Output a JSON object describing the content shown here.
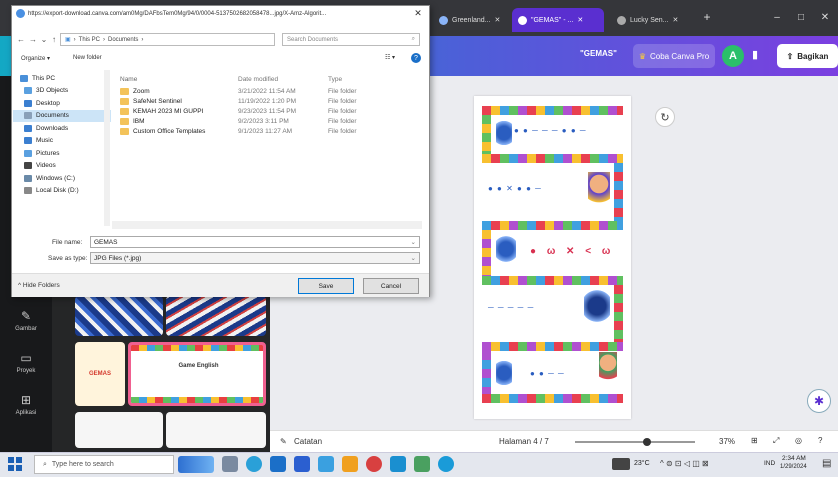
{
  "browser": {
    "popup_url": "https://export-download.canva.com/am0Mg/DAFbsTem0Mg/94/0/0004-5137502682058478...jpg/X-Amz-Algorit...",
    "tabs": [
      {
        "label": "Greenland..."
      },
      {
        "label": "\"GEMAS\" - ...",
        "active": true
      },
      {
        "label": "Lucky Sen..."
      }
    ],
    "new_tab": "+",
    "win_controls": [
      "–",
      "□",
      "✕"
    ]
  },
  "canva": {
    "doc_title": "\"GEMAS\"",
    "pro_button": "Coba Canva Pro",
    "avatar_letter": "A",
    "share_button": "Bagikan",
    "rail": [
      {
        "label": "Gambar",
        "icon": "draw-icon"
      },
      {
        "label": "Proyek",
        "icon": "folder-icon"
      },
      {
        "label": "Aplikasi",
        "icon": "apps-icon"
      }
    ],
    "thumb_text_1": "GEMAS",
    "thumb_text_2": "Game English",
    "footer": {
      "notes": "Catatan",
      "page": "Halaman 4 / 7",
      "zoom": "37%",
      "zoom_fraction": 0.6
    },
    "board_words": {
      "row1": "● ● ─ ─ ─ ● ● ─",
      "row2": "● ● ✕ ● ● ─",
      "row3": "● ω ✕ < ω",
      "row4": "─ ─ ─ ─ ─",
      "row5": "● ● ─ ─"
    }
  },
  "dialog": {
    "title_url": "https://export-download.canva.com/am0Mg/DAFbsTem0Mg/94/0/0004-5137502682058478...jpg/X-Amz-Algorit...",
    "address": [
      "This PC",
      "Documents"
    ],
    "search_placeholder": "Search Documents",
    "organize": "Organize ▾",
    "new_folder": "New folder",
    "tree": [
      {
        "label": "This PC",
        "color": "#4a90d9"
      },
      {
        "label": "3D Objects",
        "color": "#5aa0e0"
      },
      {
        "label": "Desktop",
        "color": "#3b7fd0"
      },
      {
        "label": "Documents",
        "color": "#8aa0b8",
        "selected": true
      },
      {
        "label": "Downloads",
        "color": "#3b7fd0"
      },
      {
        "label": "Music",
        "color": "#3b7fd0"
      },
      {
        "label": "Pictures",
        "color": "#5aa0e0"
      },
      {
        "label": "Videos",
        "color": "#444"
      },
      {
        "label": "Windows (C:)",
        "color": "#6a8aa8"
      },
      {
        "label": "Local Disk (D:)",
        "color": "#888"
      }
    ],
    "columns": {
      "name": "Name",
      "date": "Date modified",
      "type": "Type"
    },
    "files": [
      {
        "name": "Zoom",
        "date": "3/21/2022 11:54 AM",
        "type": "File folder"
      },
      {
        "name": "SafeNet Sentinel",
        "date": "11/19/2022 1:20 PM",
        "type": "File folder"
      },
      {
        "name": "KEMAH 2023 MI GUPPI",
        "date": "9/23/2023 11:54 PM",
        "type": "File folder"
      },
      {
        "name": "IBM",
        "date": "9/2/2023 3:11 PM",
        "type": "File folder"
      },
      {
        "name": "Custom Office Templates",
        "date": "9/1/2023 11:27 AM",
        "type": "File folder"
      }
    ],
    "file_name_label": "File name:",
    "file_name_value": "GEMAS",
    "save_type_label": "Save as type:",
    "save_type_value": "JPG Files (*.jpg)",
    "hide_folders": "Hide Folders",
    "save_button": "Save",
    "cancel_button": "Cancel"
  },
  "taskbar": {
    "search_placeholder": "Type here to search",
    "temperature": "23°C",
    "lang": "IND",
    "time": "2:34 AM",
    "date": "1/29/2024"
  }
}
